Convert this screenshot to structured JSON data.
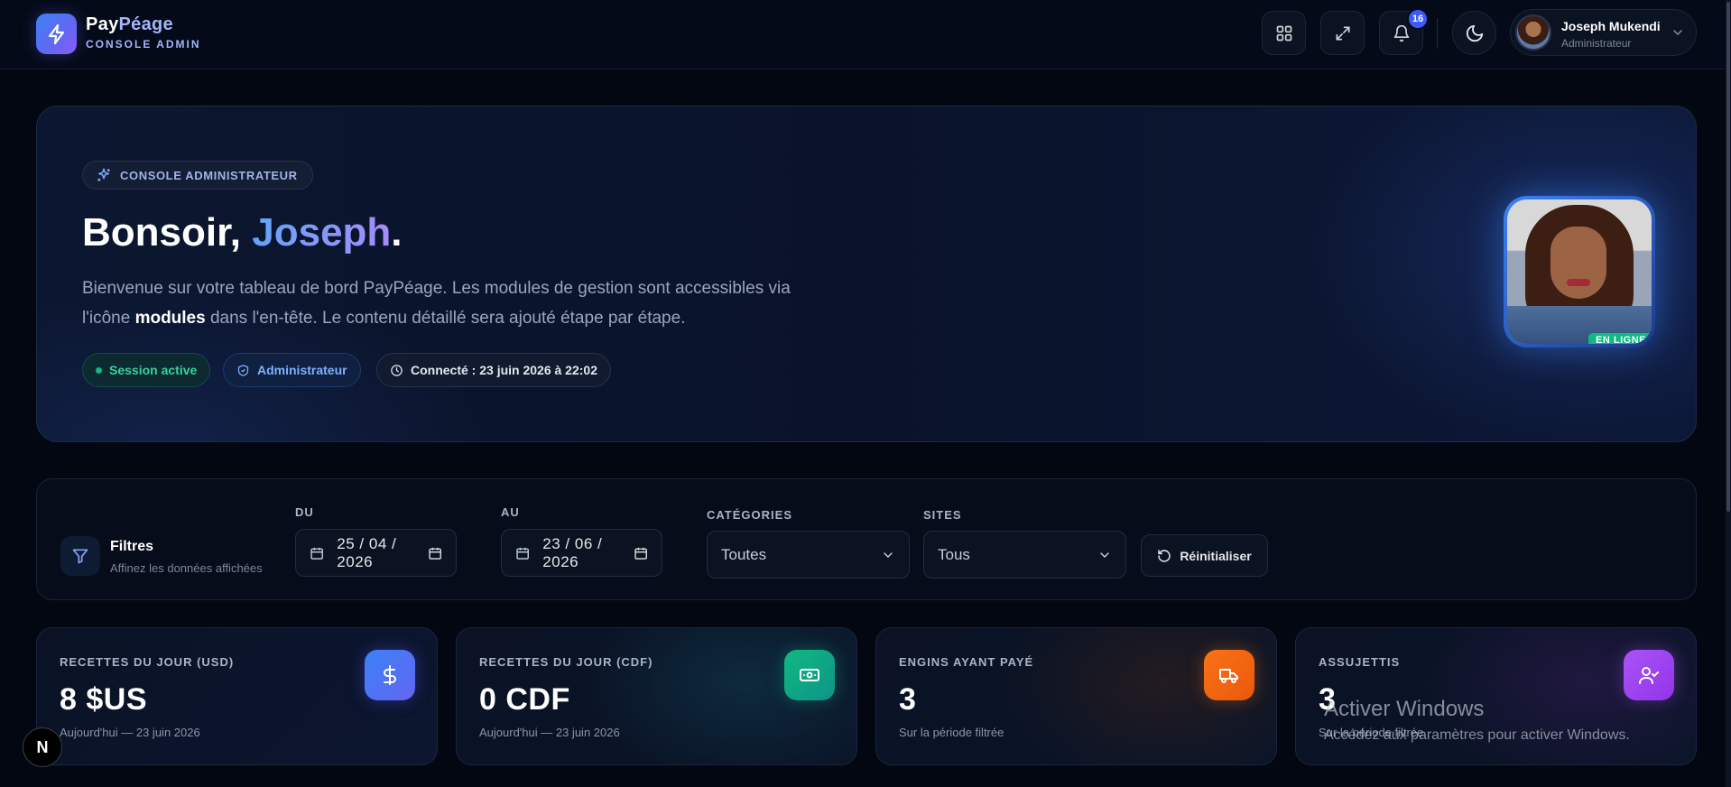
{
  "header": {
    "brand_part1": "Pay",
    "brand_part2": "Péage",
    "brand_sub": "CONSOLE ADMIN",
    "notification_count": "16",
    "user_name": "Joseph Mukendi",
    "user_role": "Administrateur",
    "icons": [
      "grid-icon",
      "fullscreen-icon",
      "bell-icon",
      "moon-icon",
      "chevron-down-icon"
    ]
  },
  "hero": {
    "badge": "CONSOLE ADMINISTRATEUR",
    "greeting": "Bonsoir, ",
    "name": "Joseph",
    "punct": ".",
    "text_part1": "Bienvenue sur votre tableau de bord PayPéage. Les modules de gestion sont accessibles via l'icône ",
    "text_bold": "modules",
    "text_part2": " dans l'en-tête. Le contenu détaillé sera ajouté étape par étape.",
    "pill_session": "Session active",
    "pill_role": "Administrateur",
    "pill_connected": "Connecté : 23 juin 2026 à 22:02",
    "online_tag": "EN LIGNE"
  },
  "filters": {
    "title": "Filtres",
    "subtitle": "Affinez les données affichées",
    "from_label": "DU",
    "from_value": "25 / 04 / 2026",
    "to_label": "AU",
    "to_value": "23 / 06 / 2026",
    "categories_label": "CATÉGORIES",
    "categories_value": "Toutes",
    "sites_label": "SITES",
    "sites_value": "Tous",
    "reset_label": "Réinitialiser"
  },
  "stats": [
    {
      "label": "RECETTES DU JOUR (USD)",
      "value": "8 $US",
      "sub": "Aujourd'hui — 23 juin 2026",
      "icon": "dollar-icon",
      "color": "#4f46e5"
    },
    {
      "label": "RECETTES DU JOUR (CDF)",
      "value": "0 CDF",
      "sub": "Aujourd'hui — 23 juin 2026",
      "icon": "banknote-icon",
      "color": "#10b981"
    },
    {
      "label": "ENGINS AYANT PAYÉ",
      "value": "3",
      "sub": "Sur la période filtrée",
      "icon": "truck-icon",
      "color": "#f97316"
    },
    {
      "label": "ASSUJETTIS",
      "value": "3",
      "sub": "Sur la période filtrée",
      "icon": "user-check-icon",
      "color": "#a855f7"
    }
  ],
  "watermark": {
    "title": "Activer Windows",
    "sub": "Accédez aux paramètres pour activer Windows."
  },
  "next_badge": "N"
}
